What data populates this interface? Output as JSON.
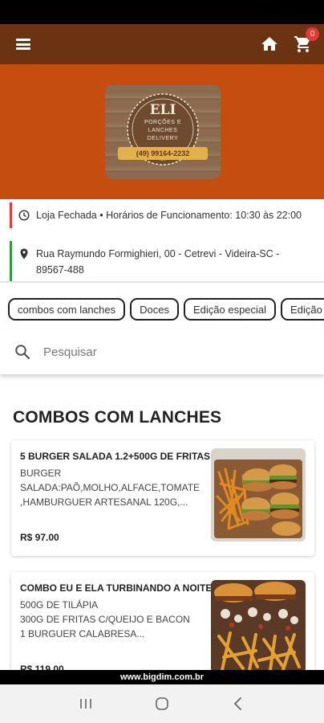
{
  "header": {
    "cart_count": "0",
    "icons": [
      "menu-icon",
      "home-icon",
      "cart-icon"
    ]
  },
  "logo": {
    "title": "ELI",
    "line1": "PORÇÕES E",
    "line2": "LANCHES",
    "line3": "DELIVERY",
    "phone": "(49) 99164-2232"
  },
  "store_info": {
    "status": "Loja Fechada • Horários de Funcionamento: 10:30 às 22:00",
    "address": "Rua Raymundo Formighieri, 00 - Cetrevi - Videira-SC - 89567-488"
  },
  "categories": [
    "combos com lanches",
    "Doces",
    "Edição especial",
    "Edição"
  ],
  "search": {
    "placeholder": "Pesquisar"
  },
  "section": {
    "title": "COMBOS COM LANCHES"
  },
  "products": [
    {
      "name": "5 BURGER SALADA 1.2+500G DE FRITAS",
      "description": "BURGER SALADA:PAÕ,MOLHO,ALFACE,TOMATE ,HAMBURGUER ARTESANAL 120G,...",
      "price": "R$ 97.00"
    },
    {
      "name": "COMBO EU E ELA TURBINANDO A NOITE",
      "description": "500G DE TILÁPIA\n300G DE FRITAS C/QUEIJO E BACON\n1 BURGUER CALABRESA...",
      "price": "R$ 119.00"
    }
  ],
  "footer": {
    "url": "www.bigdim.com.br"
  },
  "colors": {
    "app_bar": "#6b3311",
    "hero": "#c44d0f",
    "status_closed": "#e53935",
    "address_marker": "#2e9b40"
  }
}
